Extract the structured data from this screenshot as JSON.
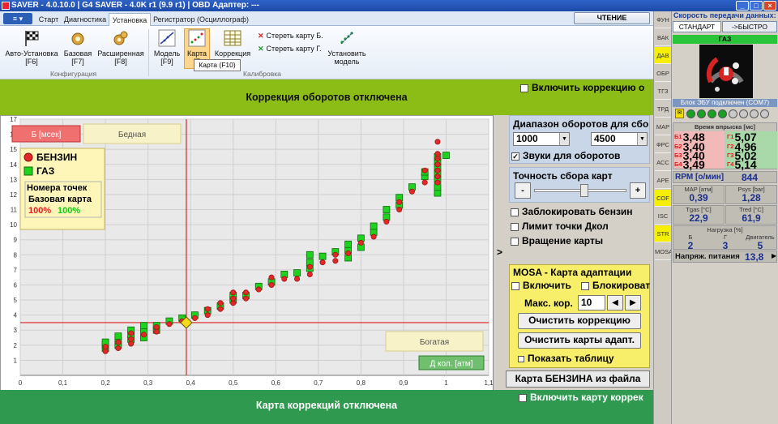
{
  "title": "SAVER - 4.0.10.0  |  G4 SAVER - 4.0K r1 (9.9 r1)  |  OBD Адаптер: ---",
  "window_buttons": {
    "min": "_",
    "max": "□",
    "close": "×"
  },
  "file_menu": "≡ ▾",
  "tabs": [
    "Старт",
    "Диагностика",
    "Установка",
    "Регистратор (Осциллограф)"
  ],
  "read_button": "ЧТЕНИЕ",
  "ribbon": {
    "config_group": "Конфигурация",
    "calib_group": "Калибровка",
    "auto_setup": [
      "Авто-Установка",
      "[F6]"
    ],
    "base": [
      "Базовая",
      "[F7]"
    ],
    "extended": [
      "Расширенная",
      "[F8]"
    ],
    "model": [
      "Модель",
      "[F9]"
    ],
    "map": [
      "Карта",
      "[F"
    ],
    "correction": "Коррекция",
    "erase_b": "Стереть карту Б.",
    "erase_g": "Стереть карту Г.",
    "set_model": [
      "Установить",
      "модель"
    ],
    "tooltip": "Карта (F10)"
  },
  "top_bar": {
    "checkbox": "Включить коррекцию о",
    "message": "Коррекция оборотов отключена"
  },
  "bottom_bar": {
    "checkbox": "Включить карту коррек",
    "message": "Карта коррекций отключена"
  },
  "chart_data": {
    "type": "scatter",
    "xlabel": "Д кол. [атм]",
    "ylabel": "Б [мсек]",
    "xlim": [
      0,
      1.1
    ],
    "ylim": [
      0,
      17
    ],
    "x_ticks": [
      "0",
      "0,1",
      "0,2",
      "0,3",
      "0,4",
      "0,5",
      "0,6",
      "0,7",
      "0,8",
      "0,9",
      "1",
      "1,1"
    ],
    "y_ticks": [
      "1",
      "2",
      "3",
      "4",
      "5",
      "6",
      "7",
      "8",
      "9",
      "10",
      "11",
      "12",
      "13",
      "14",
      "15",
      "16",
      "17"
    ],
    "lean_label": "Бедная",
    "rich_label": "Богатая",
    "legend": {
      "petrol": "БЕНЗИН",
      "gas": "ГАЗ",
      "points_title": "Номера точек",
      "base_map": "Базовая карта",
      "petrol_pct": "100%",
      "gas_pct": "100%"
    },
    "crosshair": {
      "x": 0.39,
      "y": 3.5
    },
    "series": [
      {
        "name": "ГАЗ",
        "color": "#1ed21e",
        "points": [
          [
            0.2,
            1.8
          ],
          [
            0.2,
            2.0
          ],
          [
            0.2,
            2.2
          ],
          [
            0.23,
            2.0
          ],
          [
            0.23,
            2.3
          ],
          [
            0.23,
            2.6
          ],
          [
            0.26,
            2.4
          ],
          [
            0.26,
            2.7
          ],
          [
            0.26,
            3.0
          ],
          [
            0.29,
            2.5
          ],
          [
            0.29,
            2.9
          ],
          [
            0.29,
            3.3
          ],
          [
            0.32,
            3.0
          ],
          [
            0.32,
            3.3
          ],
          [
            0.35,
            3.6
          ],
          [
            0.38,
            3.8
          ],
          [
            0.41,
            4.0
          ],
          [
            0.44,
            4.3
          ],
          [
            0.47,
            4.6
          ],
          [
            0.5,
            5.0
          ],
          [
            0.5,
            5.3
          ],
          [
            0.53,
            5.3
          ],
          [
            0.56,
            5.9
          ],
          [
            0.59,
            6.2
          ],
          [
            0.62,
            6.7
          ],
          [
            0.65,
            6.8
          ],
          [
            0.68,
            7.1
          ],
          [
            0.68,
            7.5
          ],
          [
            0.68,
            8.0
          ],
          [
            0.71,
            7.9
          ],
          [
            0.74,
            8.2
          ],
          [
            0.77,
            7.8
          ],
          [
            0.77,
            8.3
          ],
          [
            0.77,
            8.7
          ],
          [
            0.8,
            8.5
          ],
          [
            0.8,
            9.1
          ],
          [
            0.83,
            9.5
          ],
          [
            0.83,
            9.9
          ],
          [
            0.86,
            10.5
          ],
          [
            0.86,
            11.0
          ],
          [
            0.89,
            11.3
          ],
          [
            0.89,
            11.8
          ],
          [
            0.92,
            12.5
          ],
          [
            0.95,
            13.2
          ],
          [
            0.95,
            13.5
          ],
          [
            0.98,
            12.1
          ],
          [
            0.98,
            12.5
          ],
          [
            0.98,
            13.0
          ],
          [
            0.98,
            13.4
          ],
          [
            0.98,
            13.8
          ],
          [
            0.98,
            14.2
          ],
          [
            0.98,
            14.5
          ],
          [
            1.0,
            14.6
          ]
        ]
      },
      {
        "name": "БЕНЗИН",
        "color": "#e32626",
        "points": [
          [
            0.2,
            1.6
          ],
          [
            0.2,
            1.9
          ],
          [
            0.23,
            1.8
          ],
          [
            0.23,
            2.2
          ],
          [
            0.26,
            2.1
          ],
          [
            0.26,
            2.4
          ],
          [
            0.26,
            2.8
          ],
          [
            0.29,
            2.7
          ],
          [
            0.32,
            2.9
          ],
          [
            0.32,
            3.2
          ],
          [
            0.35,
            3.4
          ],
          [
            0.38,
            3.6
          ],
          [
            0.41,
            3.8
          ],
          [
            0.44,
            4.0
          ],
          [
            0.44,
            4.4
          ],
          [
            0.47,
            4.4
          ],
          [
            0.47,
            4.8
          ],
          [
            0.5,
            4.8
          ],
          [
            0.5,
            5.1
          ],
          [
            0.5,
            5.5
          ],
          [
            0.53,
            5.1
          ],
          [
            0.53,
            5.5
          ],
          [
            0.56,
            5.7
          ],
          [
            0.59,
            6.0
          ],
          [
            0.59,
            6.5
          ],
          [
            0.62,
            6.4
          ],
          [
            0.65,
            6.4
          ],
          [
            0.68,
            6.7
          ],
          [
            0.68,
            7.2
          ],
          [
            0.71,
            7.5
          ],
          [
            0.74,
            7.6
          ],
          [
            0.74,
            8.0
          ],
          [
            0.77,
            8.1
          ],
          [
            0.8,
            8.8
          ],
          [
            0.83,
            9.2
          ],
          [
            0.86,
            10.2
          ],
          [
            0.89,
            11.0
          ],
          [
            0.89,
            11.5
          ],
          [
            0.92,
            12.2
          ],
          [
            0.95,
            12.8
          ],
          [
            0.95,
            13.6
          ],
          [
            0.98,
            12.8
          ],
          [
            0.98,
            13.2
          ],
          [
            0.98,
            13.6
          ],
          [
            0.98,
            14.0
          ],
          [
            0.98,
            14.4
          ],
          [
            0.98,
            14.7
          ],
          [
            0.98,
            15.5
          ]
        ]
      }
    ]
  },
  "side_arrow": ">",
  "rpm_range": {
    "title": "Диапазон оборотов для сбо",
    "min": "1000",
    "max": "4500",
    "sounds": "Звуки для оборотов"
  },
  "accuracy": {
    "title": "Точность сбора карт",
    "minus": "-",
    "plus": "+",
    "slider_level": 0.55
  },
  "options": [
    "Заблокировать бензин",
    "Лимит точки Дкол",
    "Вращение карты"
  ],
  "mosa": {
    "title": "MOSA - Карта адаптации",
    "enable": "Включить",
    "block": "Блокироват",
    "max_cor_label": "Макс. кор.",
    "max_cor": "10",
    "clear_cor": "Очистить коррекцию",
    "clear_maps": "Очистить карты адапт.",
    "show_table": "Показать таблицу"
  },
  "load_map": "Карта БЕНЗИНА из файла",
  "indicators": [
    "ФУН",
    "ВАК",
    "ДАВ",
    "ОБР",
    "ТГЗ",
    "ТРД",
    "МАР",
    "ФРС",
    "АСС",
    "АРЕ",
    "СОF",
    "ISC",
    "STR",
    "MOSA"
  ],
  "right_panel": {
    "speed_title": "Скорость передачи данных:",
    "std": "СТАНДАРТ",
    "fast": "->БЫСТРО",
    "gas_label": "ГАЗ",
    "ecu": "Блок ЭБУ подключен (COM7)",
    "injection_title": "Время впрыска [мс]",
    "petrol_keys": [
      "Б1",
      "Б2",
      "Б3",
      "Б4"
    ],
    "petrol": [
      "3,48",
      "3,40",
      "3,40",
      "3,49"
    ],
    "gas_keys": [
      "Г1",
      "Г2",
      "Г3",
      "Г4"
    ],
    "gas": [
      "5,07",
      "4,96",
      "5,02",
      "5,14"
    ],
    "rpm_label": "RPM [о/мин]",
    "rpm": "844",
    "map_label": "MAP [атм]",
    "map": "0,39",
    "psys_label": "Psys [bar]",
    "psys": "1,28",
    "tgas_label": "Tgas [°C]",
    "tgas": "22,9",
    "tred_label": "Tred [°C]",
    "tred": "61,9",
    "load_title": "Нагрузка [%]",
    "b_label": "Б",
    "b": "2",
    "g_label": "Г",
    "g": "3",
    "engine_label": "Двигатель",
    "engine": "5",
    "voltage_label": "Напряж. питания",
    "voltage": "13,8"
  }
}
